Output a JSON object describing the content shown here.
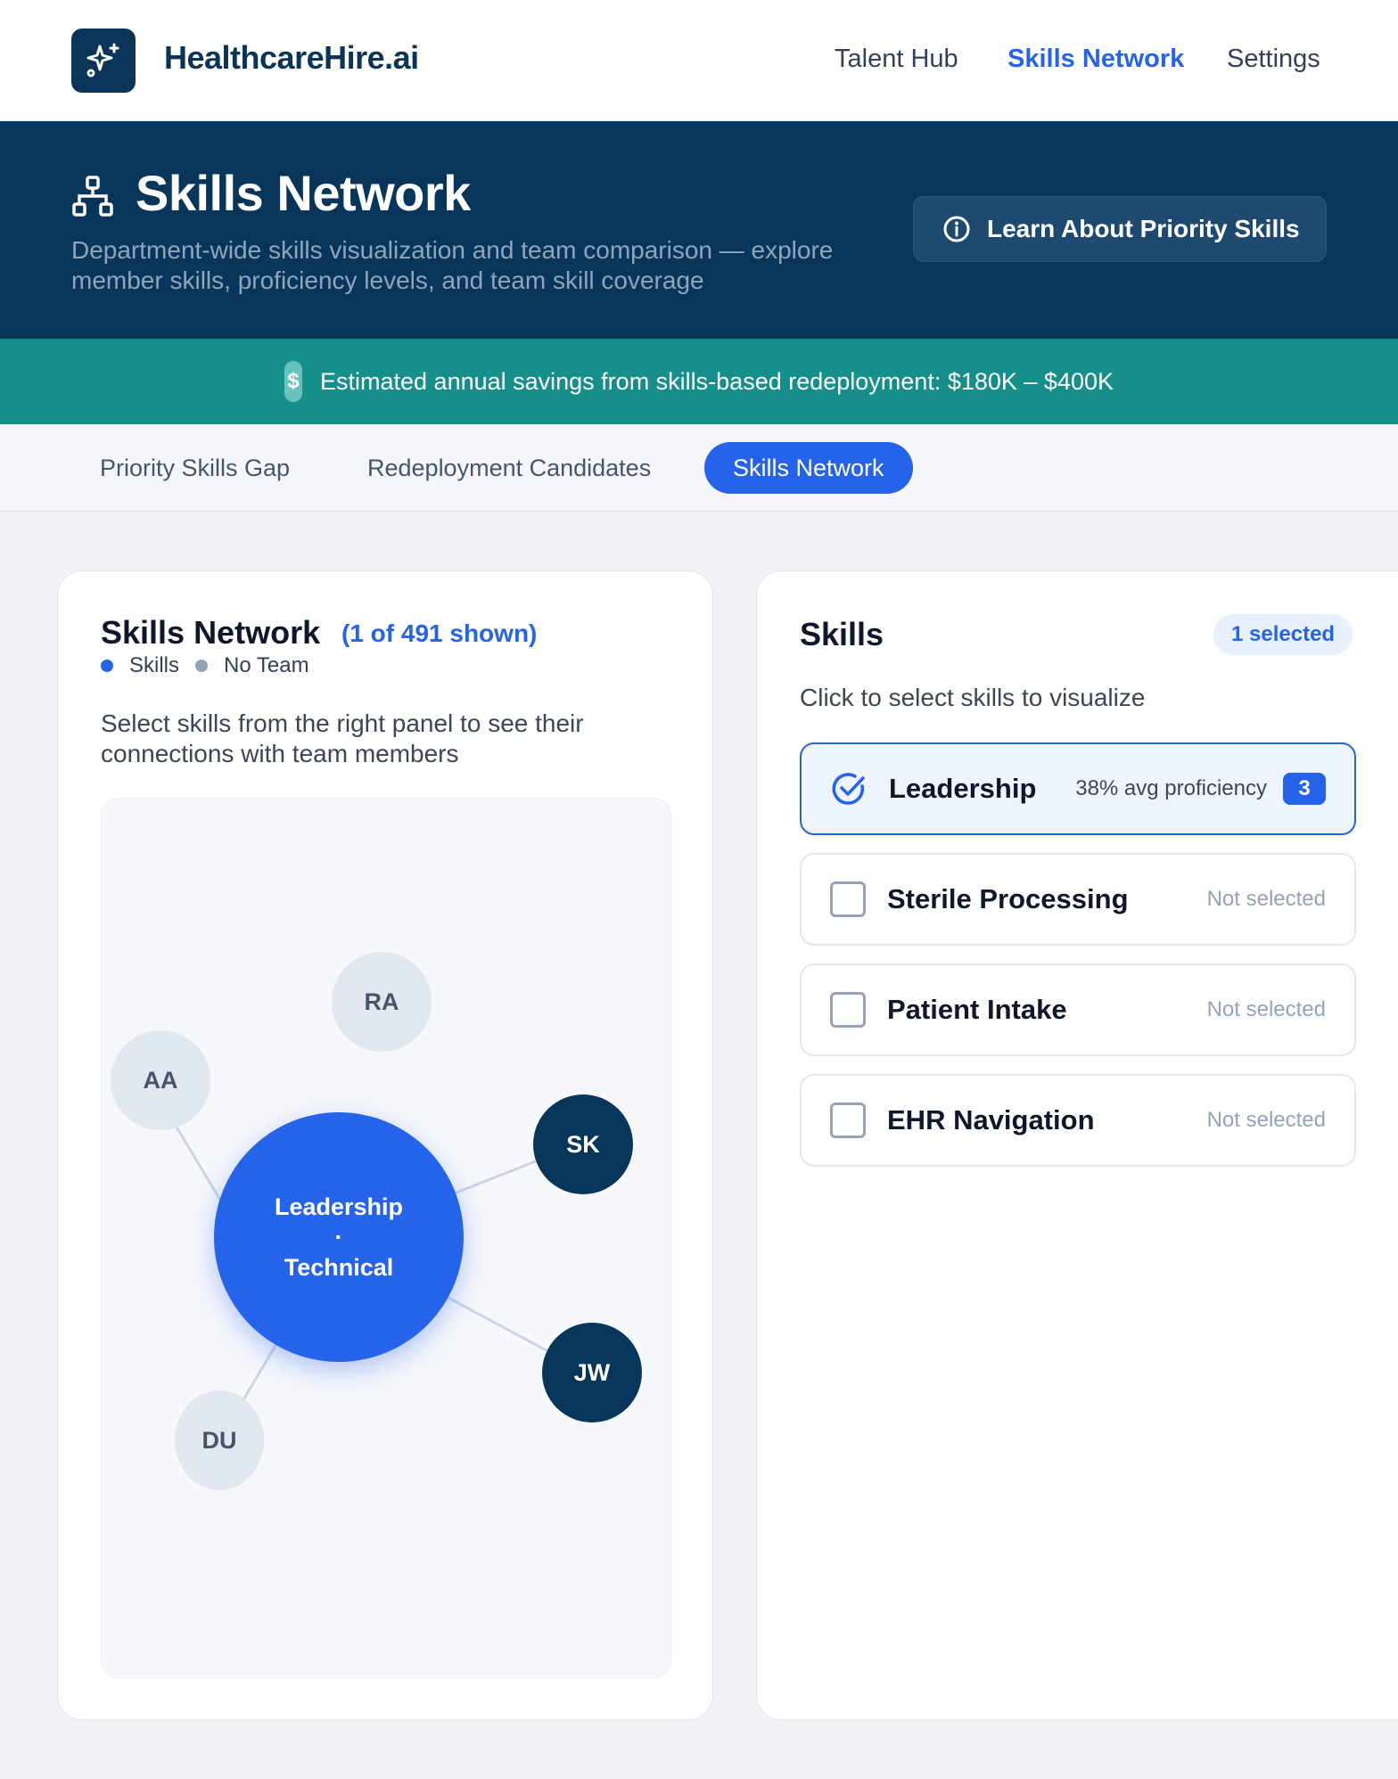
{
  "topbar": {
    "brand": "HealthcareHire.ai",
    "logo_icon": "sparkles-icon",
    "nav": [
      {
        "label": "Talent Hub",
        "active": false
      },
      {
        "label": "Skills Network",
        "active": true
      },
      {
        "label": "Settings",
        "active": false
      }
    ]
  },
  "hero": {
    "icon": "network-hierarchy-icon",
    "title": "Skills Network",
    "subtitle": "Department-wide skills visualization and team comparison — explore member skills, proficiency levels, and team skill coverage",
    "learn_button": "Learn About Priority Skills",
    "learn_icon": "info-icon"
  },
  "savings": {
    "icon": "dollar-icon",
    "symbol": "$",
    "text": "Estimated annual savings from skills-based redeployment: $180K – $400K"
  },
  "tabs": [
    {
      "label": "Priority Skills Gap",
      "active": false
    },
    {
      "label": "Redeployment Candidates",
      "active": false
    },
    {
      "label": "Skills Network",
      "active": true
    }
  ],
  "network": {
    "title": "Skills Network",
    "shown": "(1 of 491 shown)",
    "legend": [
      {
        "label": "Skills",
        "color": "#2563eb"
      },
      {
        "label": "No Team",
        "color": "#94a3b8"
      }
    ],
    "description": "Select skills from the right panel to see their connections with team members",
    "center": {
      "line1": "Leadership",
      "separator": "·",
      "line2": "Technical"
    },
    "members": [
      {
        "initials": "RA",
        "style": "no-team"
      },
      {
        "initials": "AA",
        "style": "no-team"
      },
      {
        "initials": "SK",
        "style": "team"
      },
      {
        "initials": "JW",
        "style": "team"
      },
      {
        "initials": "DU",
        "style": "no-team"
      }
    ]
  },
  "skills_panel": {
    "title": "Skills",
    "selected_badge": "1 selected",
    "subtitle": "Click to select skills to visualize",
    "items": [
      {
        "name": "Leadership",
        "selected": true,
        "proficiency": "38% avg proficiency",
        "count": "3"
      },
      {
        "name": "Sterile Processing",
        "selected": false,
        "status": "Not selected"
      },
      {
        "name": "Patient Intake",
        "selected": false,
        "status": "Not selected"
      },
      {
        "name": "EHR Navigation",
        "selected": false,
        "status": "Not selected"
      }
    ]
  },
  "colors": {
    "brand_navy": "#08365b",
    "accent_blue": "#2563eb",
    "savings_teal": "#168f8a"
  }
}
